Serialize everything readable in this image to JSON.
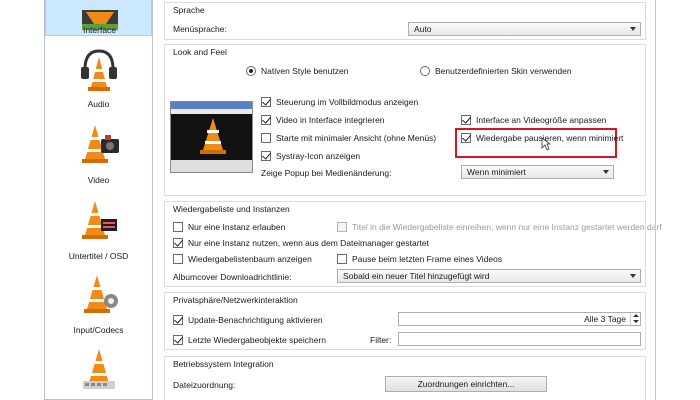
{
  "sidebar": {
    "items": [
      {
        "label": "Interface",
        "icon": "interface-icon",
        "active": true
      },
      {
        "label": "Audio",
        "icon": "audio-headphones-cone-icon"
      },
      {
        "label": "Video",
        "icon": "video-cone-icon"
      },
      {
        "label": "Untertitel / OSD",
        "icon": "subtitles-cone-icon"
      },
      {
        "label": "Input/Codecs",
        "icon": "input-codecs-cone-icon"
      },
      {
        "label": "",
        "icon": "hotkeys-cone-icon"
      }
    ]
  },
  "sprache": {
    "title": "Sprache",
    "menu_label": "Menüsprache:",
    "menu_value": "Auto"
  },
  "look": {
    "title": "Look and Feel",
    "radio_native": "Nativen Style benutzen",
    "radio_skin": "Benutzerdefinierten Skin verwenden",
    "cb_fullscreen": "Steuerung im Vollbildmodus anzeigen",
    "cb_video_integrate": "Video in Interface integrieren",
    "cb_minimal": "Starte mit minimaler Ansicht (ohne Menüs)",
    "cb_systray": "Systray-Icon anzeigen",
    "cb_resize": "Interface an Videogröße anpassen",
    "cb_pause": "Wiedergabe pausieren, wenn minimiert",
    "popup_label": "Zeige Popup bei Medienänderung:",
    "popup_value": "Wenn minimiert"
  },
  "playlist": {
    "title": "Wiedergabeliste und Instanzen",
    "cb_one_instance": "Nur eine Instanz erlauben",
    "cb_title_enqueue": "Titel in die Wiedergabeliste einreihen, wenn nur eine Instanz gestartet werden darf",
    "cb_filemanager": "Nur eine Instanz nutzen, wenn aus dem Dateimanager gestartet",
    "cb_tree": "Wiedergabelistenbaum anzeigen",
    "cb_pause_last": "Pause beim letzten Frame eines Videos",
    "album_label": "Albumcover Downloadrichtlinie:",
    "album_value": "Sobald ein neuer Titel hinzugefügt wird"
  },
  "privacy": {
    "title": "Privatsphäre/Netzwerkinteraktion",
    "cb_update": "Update-Benachrichtigung aktivieren",
    "update_value": "Alle 3 Tage",
    "cb_recent": "Letzte Wiedergabeobjekte speichern",
    "filter_label": "Filter:"
  },
  "os": {
    "title": "Betriebssystem Integration",
    "file_label": "Dateizuordnung:",
    "assoc_button": "Zuordnungen einrichten..."
  },
  "colors": {
    "highlight": "#d9141e",
    "active_item_bg": "#cce8ff",
    "vlc_orange": "#f28a1a"
  }
}
